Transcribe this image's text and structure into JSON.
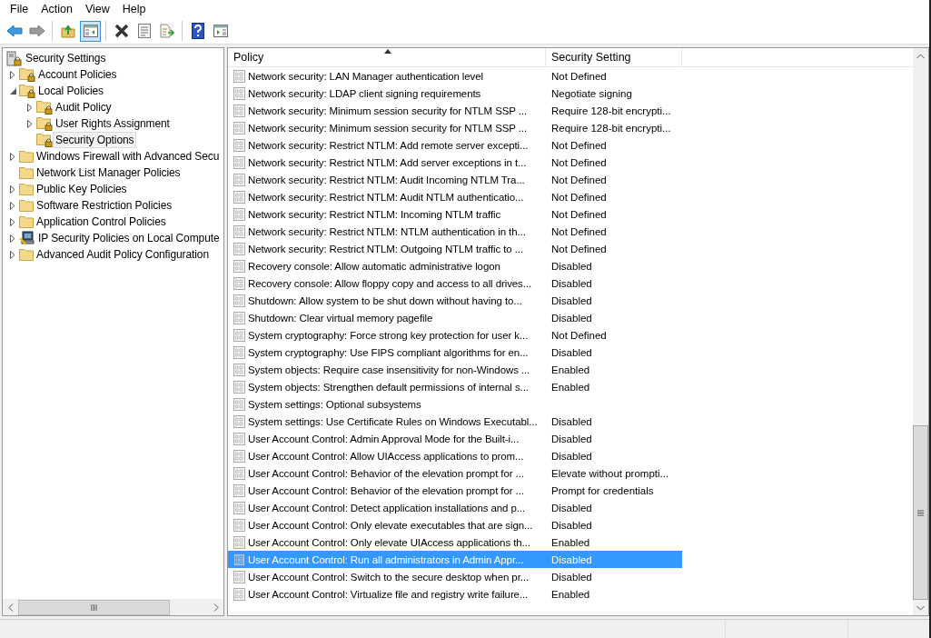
{
  "menu": [
    "File",
    "Action",
    "View",
    "Help"
  ],
  "toolbar": [
    [
      {
        "kind": "back",
        "pressed": false
      },
      {
        "kind": "forward",
        "pressed": false
      }
    ],
    [
      {
        "kind": "up",
        "pressed": false
      },
      {
        "kind": "tree",
        "pressed": true
      }
    ],
    [
      {
        "kind": "delete",
        "pressed": false
      },
      {
        "kind": "properties",
        "pressed": false
      },
      {
        "kind": "export",
        "pressed": false
      }
    ],
    [
      {
        "kind": "help",
        "pressed": false
      },
      {
        "kind": "view",
        "pressed": false
      }
    ]
  ],
  "tree": {
    "label": "Security Settings",
    "selected": false,
    "children": [
      {
        "label": "Account Policies",
        "expanded": false,
        "kind": "locked",
        "selected": false
      },
      {
        "label": "Local Policies",
        "expanded": true,
        "kind": "locked",
        "selected": false,
        "children": [
          {
            "label": "Audit Policy",
            "expanded": false,
            "kind": "locked",
            "selected": false
          },
          {
            "label": "User Rights Assignment",
            "expanded": false,
            "kind": "locked",
            "selected": false
          },
          {
            "label": "Security Options",
            "kind": "locked",
            "selected": true
          }
        ]
      },
      {
        "label": "Windows Firewall with Advanced Secu",
        "expanded": false,
        "kind": "folder",
        "selected": false
      },
      {
        "label": "Network List Manager Policies",
        "kind": "folder",
        "selected": false
      },
      {
        "label": "Public Key Policies",
        "expanded": false,
        "kind": "folder",
        "selected": false
      },
      {
        "label": "Software Restriction Policies",
        "expanded": false,
        "kind": "folder",
        "selected": false
      },
      {
        "label": "Application Control Policies",
        "expanded": false,
        "kind": "folder",
        "selected": false
      },
      {
        "label": "IP Security Policies on Local Compute",
        "expanded": false,
        "kind": "computer",
        "selected": false
      },
      {
        "label": "Advanced Audit Policy Configuration",
        "expanded": false,
        "kind": "folder",
        "selected": false
      }
    ]
  },
  "table": {
    "columns": [
      "Policy",
      "Security Setting"
    ],
    "rows": [
      {
        "policy": "Network security: LAN Manager authentication level",
        "setting": "Not Defined",
        "selected": false
      },
      {
        "policy": "Network security: LDAP client signing requirements",
        "setting": "Negotiate signing",
        "selected": false
      },
      {
        "policy": "Network security: Minimum session security for NTLM SSP ...",
        "setting": "Require 128-bit encrypti...",
        "selected": false
      },
      {
        "policy": "Network security: Minimum session security for NTLM SSP ...",
        "setting": "Require 128-bit encrypti...",
        "selected": false
      },
      {
        "policy": "Network security: Restrict NTLM: Add remote server excepti...",
        "setting": "Not Defined",
        "selected": false
      },
      {
        "policy": "Network security: Restrict NTLM: Add server exceptions in t...",
        "setting": "Not Defined",
        "selected": false
      },
      {
        "policy": "Network security: Restrict NTLM: Audit Incoming NTLM Tra...",
        "setting": "Not Defined",
        "selected": false
      },
      {
        "policy": "Network security: Restrict NTLM: Audit NTLM authenticatio...",
        "setting": "Not Defined",
        "selected": false
      },
      {
        "policy": "Network security: Restrict NTLM: Incoming NTLM traffic",
        "setting": "Not Defined",
        "selected": false
      },
      {
        "policy": "Network security: Restrict NTLM: NTLM authentication in th...",
        "setting": "Not Defined",
        "selected": false
      },
      {
        "policy": "Network security: Restrict NTLM: Outgoing NTLM traffic to ...",
        "setting": "Not Defined",
        "selected": false
      },
      {
        "policy": "Recovery console: Allow automatic administrative logon",
        "setting": "Disabled",
        "selected": false
      },
      {
        "policy": "Recovery console: Allow floppy copy and access to all drives...",
        "setting": "Disabled",
        "selected": false
      },
      {
        "policy": "Shutdown: Allow system to be shut down without having to...",
        "setting": "Disabled",
        "selected": false
      },
      {
        "policy": "Shutdown: Clear virtual memory pagefile",
        "setting": "Disabled",
        "selected": false
      },
      {
        "policy": "System cryptography: Force strong key protection for user k...",
        "setting": "Not Defined",
        "selected": false
      },
      {
        "policy": "System cryptography: Use FIPS compliant algorithms for en...",
        "setting": "Disabled",
        "selected": false
      },
      {
        "policy": "System objects: Require case insensitivity for non-Windows ...",
        "setting": "Enabled",
        "selected": false
      },
      {
        "policy": "System objects: Strengthen default permissions of internal s...",
        "setting": "Enabled",
        "selected": false
      },
      {
        "policy": "System settings: Optional subsystems",
        "selected": false
      },
      {
        "policy": "System settings: Use Certificate Rules on Windows Executabl...",
        "setting": "Disabled",
        "selected": false
      },
      {
        "policy": "User Account Control: Admin Approval Mode for the Built-i...",
        "setting": "Disabled",
        "selected": false
      },
      {
        "policy": "User Account Control: Allow UIAccess applications to prom...",
        "setting": "Disabled",
        "selected": false
      },
      {
        "policy": "User Account Control: Behavior of the elevation prompt for ...",
        "setting": "Elevate without prompti...",
        "selected": false
      },
      {
        "policy": "User Account Control: Behavior of the elevation prompt for ...",
        "setting": "Prompt for credentials",
        "selected": false
      },
      {
        "policy": "User Account Control: Detect application installations and p...",
        "setting": "Disabled",
        "selected": false
      },
      {
        "policy": "User Account Control: Only elevate executables that are sign...",
        "setting": "Disabled",
        "selected": false
      },
      {
        "policy": "User Account Control: Only elevate UIAccess applications th...",
        "setting": "Enabled",
        "selected": false
      },
      {
        "policy": "User Account Control: Run all administrators in Admin Appr...",
        "setting": "Disabled",
        "selected": true
      },
      {
        "policy": "User Account Control: Switch to the secure desktop when pr...",
        "setting": "Disabled",
        "selected": false
      },
      {
        "policy": "User Account Control: Virtualize file and registry write failure...",
        "setting": "Enabled",
        "selected": false
      }
    ]
  }
}
